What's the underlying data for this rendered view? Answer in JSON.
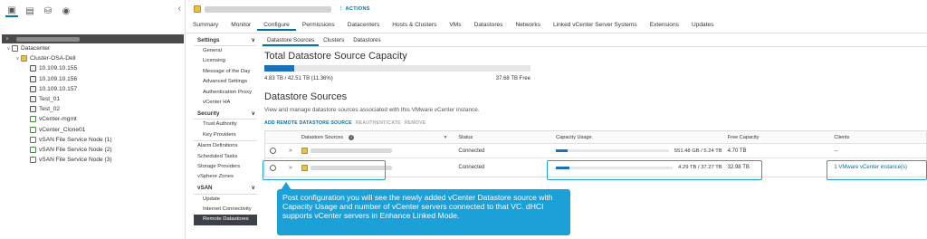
{
  "navigator": {
    "tabs": [
      {
        "icon": "hosts-clusters-icon"
      },
      {
        "icon": "vms-templates-icon"
      },
      {
        "icon": "storage-icon"
      },
      {
        "icon": "networking-icon"
      }
    ],
    "tree": [
      {
        "label": "Datacenter",
        "icon": "datacenter-icon",
        "level": 1,
        "expanded": true
      },
      {
        "label": "Cluster-OSA-Dell",
        "icon": "cluster-icon",
        "level": 2,
        "expanded": true
      },
      {
        "label": "10.109.10.155",
        "icon": "host-icon",
        "level": 3
      },
      {
        "label": "10.109.10.156",
        "icon": "host-icon",
        "level": 3
      },
      {
        "label": "10.109.10.157",
        "icon": "host-icon",
        "level": 3
      },
      {
        "label": "Test_01",
        "icon": "host-icon",
        "level": 3
      },
      {
        "label": "Test_02",
        "icon": "host-icon",
        "level": 3
      },
      {
        "label": "vCenter-mgmt",
        "icon": "vm-icon",
        "level": 3
      },
      {
        "label": "vCenter_Clone01",
        "icon": "vm-icon",
        "level": 3
      },
      {
        "label": "vSAN File Service Node (1)",
        "icon": "vm-icon",
        "level": 3
      },
      {
        "label": "vSAN File Service Node (2)",
        "icon": "vm-icon",
        "level": 3
      },
      {
        "label": "vSAN File Service Node (3)",
        "icon": "vm-icon",
        "level": 3
      }
    ]
  },
  "header": {
    "actions_label": "ACTIONS",
    "tabs": [
      "Summary",
      "Monitor",
      "Configure",
      "Permissions",
      "Datacenters",
      "Hosts & Clusters",
      "VMs",
      "Datastores",
      "Networks",
      "Linked vCenter Server Systems",
      "Extensions",
      "Updates"
    ],
    "active_tab": "Configure"
  },
  "settings": {
    "sections": [
      {
        "title": "Settings",
        "items": [
          "General",
          "Licensing",
          "Message of the Day",
          "Advanced Settings",
          "Authentication Proxy",
          "vCenter HA"
        ]
      },
      {
        "title": "Security",
        "items": [
          "Trust Authority",
          "Key Providers"
        ]
      },
      {
        "title": "",
        "items": [
          "Alarm Definitions",
          "Scheduled Tasks",
          "Storage Providers",
          "vSphere Zones"
        ]
      },
      {
        "title": "vSAN",
        "items": [
          "Update",
          "Internet Connectivity",
          "Remote Datastores"
        ]
      }
    ],
    "active_item": "Remote Datastores"
  },
  "content": {
    "sub_tabs": [
      "Datastore Sources",
      "Clusters",
      "Datastores"
    ],
    "active_sub_tab": "Datastore Sources",
    "capacity": {
      "title": "Total Datastore Source Capacity",
      "used_text": "4.83 TB / 42.51 TB (11.36%)",
      "free_text": "37.68 TB Free",
      "used_fraction": 0.1136
    },
    "sources": {
      "title": "Datastore Sources",
      "description": "View and manage datastore sources associated with this VMware vCenter instance.",
      "actions": [
        {
          "label": "ADD REMOTE DATASTORE SOURCE",
          "enabled": true
        },
        {
          "label": "REAUTHENTICATE",
          "enabled": false
        },
        {
          "label": "REMOVE",
          "enabled": false
        }
      ]
    },
    "table": {
      "columns": {
        "name": "Datastore Sources",
        "status": "Status",
        "capacity": "Capacity Usage",
        "free": "Free Capacity",
        "clients": "Clients"
      },
      "rows": [
        {
          "status": "Connected",
          "capacity": "551.48 GB / 5.24 TB",
          "used_fraction": 0.1,
          "free": "4.70 TB",
          "clients": "--"
        },
        {
          "status": "Connected",
          "capacity": "4.29 TB / 37.27 TB",
          "used_fraction": 0.115,
          "free": "32.98 TB",
          "clients": "1 VMware vCenter instance(s)"
        }
      ]
    }
  },
  "callout": {
    "text": "Post configuration you will see the newly added vCenter  Datastore source with Capacity Usage and number of vCenter servers connected to that VC. dHCI supports vCenter servers in Enhance Linked Mode."
  },
  "colors": {
    "accent": "#0072a3",
    "callout": "#1ba0d8",
    "bar": "#1a71b8"
  }
}
